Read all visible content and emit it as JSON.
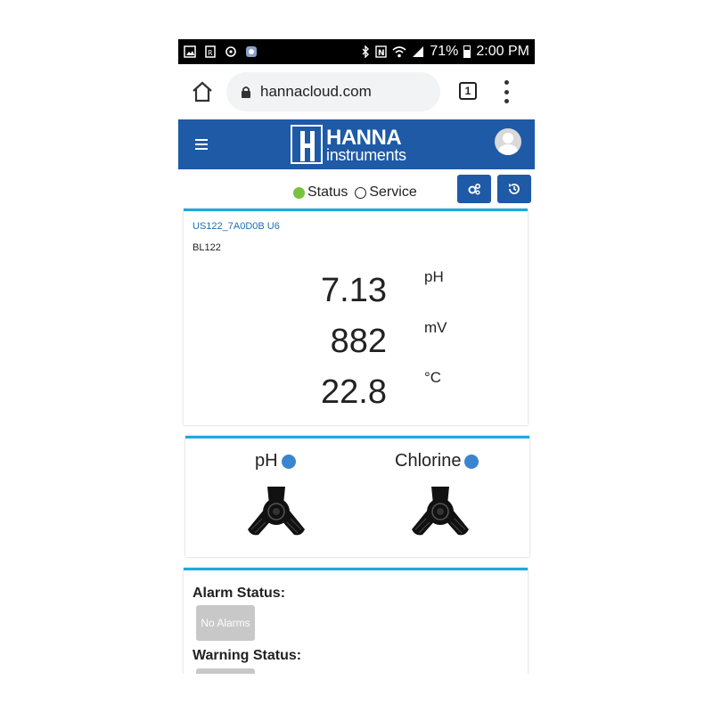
{
  "status_bar": {
    "battery": "71%",
    "time": "2:00 PM"
  },
  "browser": {
    "url": "hannacloud.com",
    "tab_count": "1"
  },
  "app": {
    "logo_line1": "HANNA",
    "logo_line2": "instruments",
    "brand_color": "#1e5aa6",
    "accent_color": "#1ba9e1"
  },
  "status_toggle": {
    "options": [
      {
        "label": "Status",
        "selected": true
      },
      {
        "label": "Service",
        "selected": false
      }
    ]
  },
  "device": {
    "id": "US122_7A0D0B U6",
    "model": "BL122",
    "readings": [
      {
        "value": "7.13",
        "unit": "pH"
      },
      {
        "value": "882",
        "unit": "mV"
      },
      {
        "value": "22.8",
        "unit": "°C"
      }
    ]
  },
  "probes": [
    {
      "label": "pH",
      "status_color": "#3a85cf"
    },
    {
      "label": "Chlorine",
      "status_color": "#3a85cf"
    }
  ],
  "alarms": {
    "alarm_title": "Alarm Status:",
    "alarm_badge": "No Alarms",
    "warning_title": "Warning Status:"
  }
}
